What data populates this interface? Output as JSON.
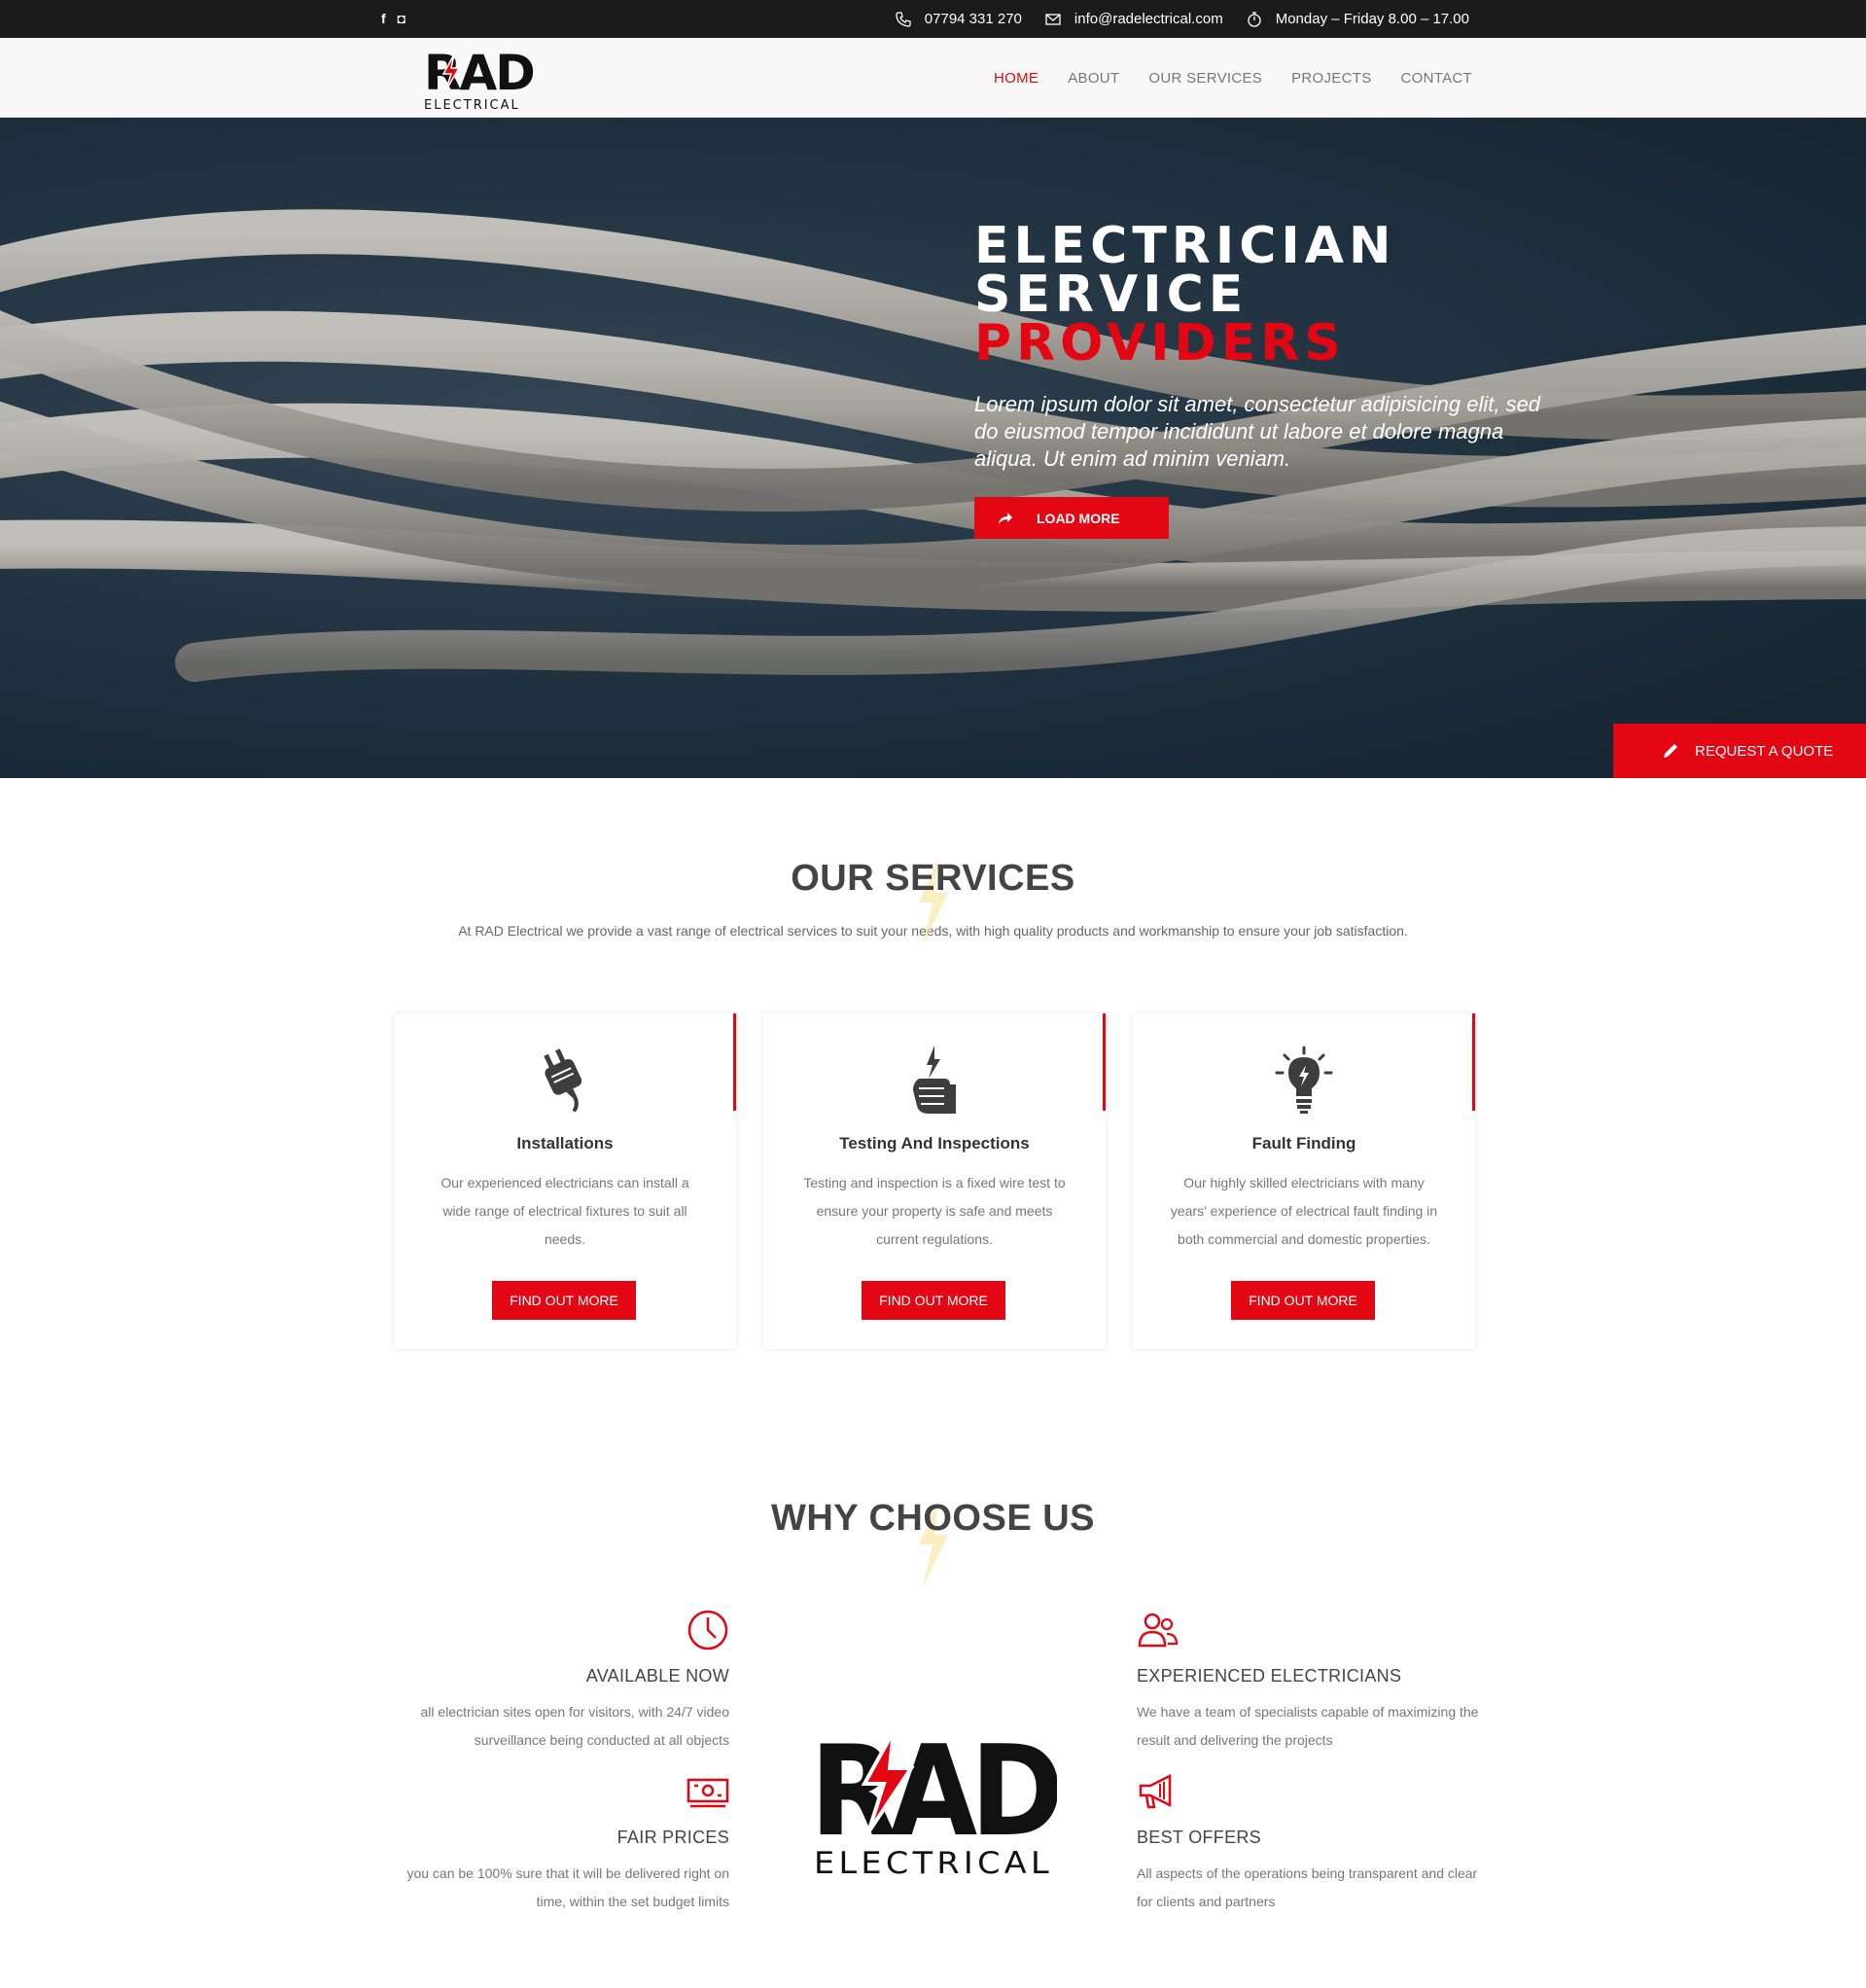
{
  "topbar": {
    "social": [
      "f",
      "◘"
    ],
    "phone": "07794 331 270",
    "email": "info@radelectrical.com",
    "hours": "Monday – Friday 8.00 – 17.00"
  },
  "brand": {
    "logo_main": "RAD",
    "logo_sub": "ELECTRICAL",
    "accent": "#e30613"
  },
  "nav": {
    "items": [
      {
        "label": "HOME",
        "active": true
      },
      {
        "label": "ABOUT"
      },
      {
        "label": "OUR SERVICES"
      },
      {
        "label": "PROJECTS"
      },
      {
        "label": "CONTACT"
      }
    ]
  },
  "hero": {
    "title_line1": "ELECTRICIAN SERVICE",
    "title_line2": "PROVIDERS",
    "subtitle": "Lorem ipsum dolor sit amet, consectetur adipisicing elit, sed do eiusmod tempor incididunt ut labore et dolore magna aliqua. Ut enim ad minim veniam.",
    "button": "LOAD MORE",
    "quote_button": "REQUEST A QUOTE"
  },
  "services": {
    "heading": "OUR SERVICES",
    "description": "At RAD Electrical we provide a vast range of electrical services to suit your needs, with high quality products and workmanship to ensure your job satisfaction.",
    "cards": [
      {
        "icon": "plug-icon",
        "title": "Installations",
        "text": "Our experienced electricians can install a wide range of electrical fixtures to suit all needs.",
        "button": "FIND OUT MORE"
      },
      {
        "icon": "hand-bolt-icon",
        "title": "Testing And Inspections",
        "text": "Testing and inspection is a fixed wire test to ensure your property is safe and meets current regulations.",
        "button": "FIND OUT MORE"
      },
      {
        "icon": "lightbulb-icon",
        "title": "Fault Finding",
        "text": "Our highly skilled electricians with many years' experience of electrical fault finding in both commercial and domestic properties.",
        "button": "FIND OUT MORE"
      }
    ]
  },
  "why": {
    "heading": "WHY CHOOSE US",
    "items": [
      {
        "icon": "clock-icon",
        "title": "AVAILABLE NOW",
        "text": "all electrician sites open for visitors, with 24/7 video surveillance being conducted at all objects"
      },
      {
        "icon": "money-icon",
        "title": "FAIR PRICES",
        "text": "you can be 100% sure that it will be delivered right on time, within the set budget limits"
      },
      {
        "icon": "users-icon",
        "title": "EXPERIENCED ELECTRICIANS",
        "text": "We have a team of specialists capable of maximizing the result and delivering the projects"
      },
      {
        "icon": "megaphone-icon",
        "title": "BEST OFFERS",
        "text": "All aspects of the operations being transparent and clear for clients and partners"
      }
    ]
  }
}
